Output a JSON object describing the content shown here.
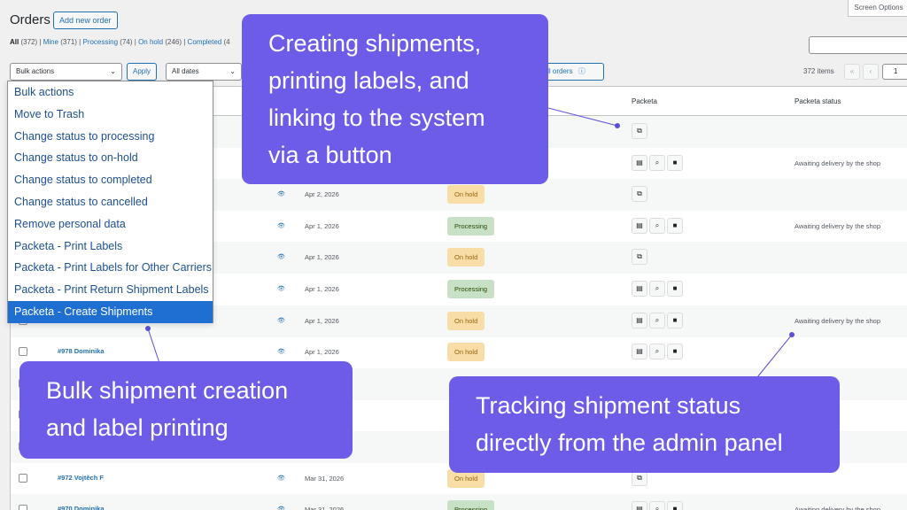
{
  "header": {
    "title": "Orders",
    "add_new": "Add new order",
    "screen_options": "Screen Options"
  },
  "filters": {
    "all": "All",
    "all_count": "(372)",
    "mine": "Mine",
    "mine_count": "(371)",
    "processing": "Processing",
    "processing_count": "(74)",
    "on_hold": "On hold",
    "on_hold_count": "(246)",
    "completed": "Completed",
    "completed_count": "(4"
  },
  "tablenav": {
    "bulk_select": "Bulk actions",
    "apply": "Apply",
    "dates_select": "All dates",
    "filter_all_orders": "e all orders",
    "items_count": "372 items",
    "first_page": "«",
    "prev_page": "‹",
    "page": "1"
  },
  "columns": {
    "packeta": "Packeta",
    "packeta_status": "Packeta status"
  },
  "bulk_menu": [
    {
      "label": "Bulk actions"
    },
    {
      "label": "Move to Trash"
    },
    {
      "label": "Change status to processing"
    },
    {
      "label": "Change status to on-hold"
    },
    {
      "label": "Change status to completed"
    },
    {
      "label": "Change status to cancelled"
    },
    {
      "label": "Remove personal data"
    },
    {
      "label": "Packeta - Print Labels"
    },
    {
      "label": "Packeta - Print Labels for Other Carriers"
    },
    {
      "label": "Packeta - Print Return Shipment Labels"
    },
    {
      "label": "Packeta - Create Shipments",
      "selected": true
    }
  ],
  "rows": [
    {
      "order": "",
      "date": "",
      "status": "",
      "packeta": "link",
      "packeta_status": ""
    },
    {
      "order": "",
      "date": "",
      "status": "",
      "packeta": "actions",
      "packeta_status": "Awaiting delivery by the shop"
    },
    {
      "order": "",
      "date": "Apr 2, 2026",
      "status": "On hold",
      "packeta": "link",
      "packeta_status": ""
    },
    {
      "order": "",
      "date": "Apr 1, 2026",
      "status": "Processing",
      "packeta": "actions",
      "packeta_status": "Awaiting delivery by the shop"
    },
    {
      "order": "",
      "date": "Apr 1, 2026",
      "status": "On hold",
      "packeta": "link",
      "packeta_status": ""
    },
    {
      "order": "",
      "date": "Apr 1, 2026",
      "status": "Processing",
      "packeta": "actions",
      "packeta_status": ""
    },
    {
      "order": "",
      "date": "Apr 1, 2026",
      "status": "On hold",
      "packeta": "actions",
      "packeta_status": "Awaiting delivery by the shop"
    },
    {
      "order": "#978 Dominika",
      "date": "Apr 1, 2026",
      "status": "On hold",
      "packeta": "actions",
      "packeta_status": ""
    },
    {
      "order": "",
      "date": "",
      "status": "",
      "packeta": "",
      "packeta_status": ""
    },
    {
      "order": "",
      "date": "",
      "status": "",
      "packeta": "",
      "packeta_status": ""
    },
    {
      "order": "",
      "date": "",
      "status": "",
      "packeta": "",
      "packeta_status": ""
    },
    {
      "order": "#972 Vojtěch F",
      "date": "Mar 31, 2026",
      "status": "On hold",
      "packeta": "link",
      "packeta_status": ""
    },
    {
      "order": "#970 Dominika",
      "date": "Mar 31, 2026",
      "status": "Processing",
      "packeta": "actions",
      "packeta_status": "Awaiting delivery by the shop"
    }
  ],
  "icons": {
    "link": "external-link-icon",
    "label": "label-document-icon",
    "search": "search-icon",
    "trash": "trash-icon",
    "preview": "eye-icon"
  },
  "callouts": {
    "top": "Creating shipments, printing labels, and linking to the system via a button",
    "left": "Bulk shipment creation and label printing",
    "right": "Tracking shipment status directly from the admin panel"
  },
  "colors": {
    "callout_bg": "#6c5ce7",
    "accent": "#2271b1",
    "on_hold_bg": "#f8dda7",
    "processing_bg": "#c6e1c6",
    "dropdown_selected": "#1e6fd1"
  }
}
